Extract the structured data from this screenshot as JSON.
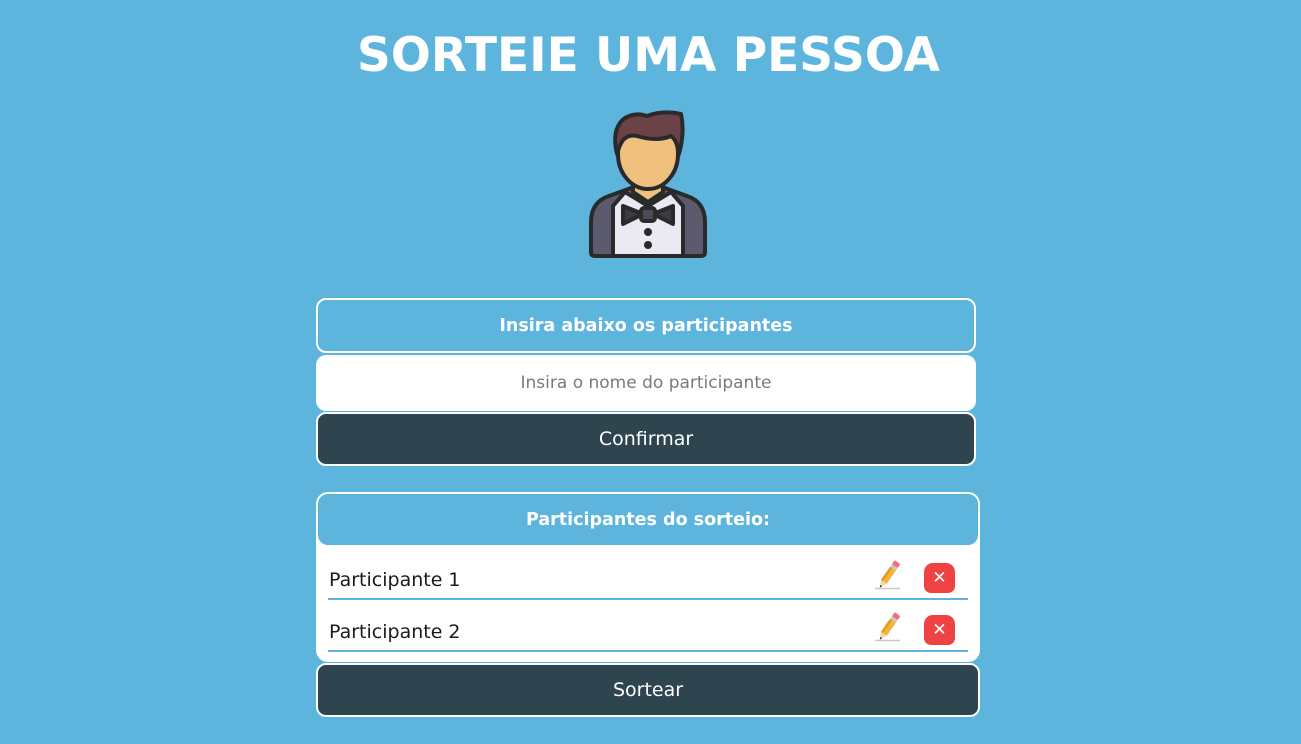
{
  "page": {
    "title": "SORTEIE UMA PESSOA"
  },
  "avatar": {
    "icon": "person-bowtie-icon"
  },
  "form": {
    "header": "Insira abaixo os participantes",
    "input_placeholder": "Insira o nome do participante",
    "input_value": "",
    "confirm_label": "Confirmar"
  },
  "participants": {
    "header": "Participantes do sorteio:",
    "items": [
      {
        "name": "Participante 1",
        "edit_icon": "pencil-icon",
        "delete_icon": "close-icon",
        "delete_glyph": "✕"
      },
      {
        "name": "Participante 2",
        "edit_icon": "pencil-icon",
        "delete_icon": "close-icon",
        "delete_glyph": "✕"
      }
    ],
    "draw_label": "Sortear"
  },
  "colors": {
    "background": "#5db5de",
    "dark_button": "#2e4550",
    "delete_red": "#ef4343",
    "white": "#ffffff"
  }
}
